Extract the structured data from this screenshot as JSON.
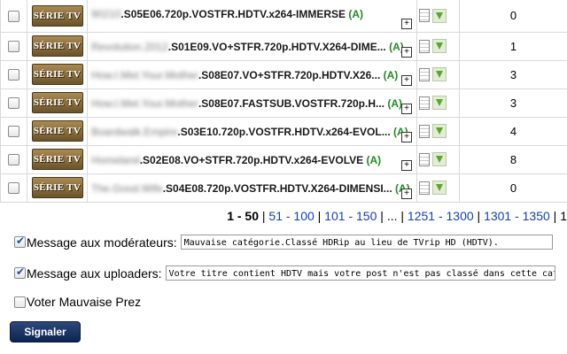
{
  "category_label": "SÉRIE TV",
  "rows": [
    {
      "blurred": "90210",
      "name": ".S05E06.720p.VOSTFR.HDTV.x264-IMMERSE",
      "tag": "(A)",
      "count": "0"
    },
    {
      "blurred": "Revolution.2012",
      "name": ".S01E09.VO+STFR.720p.HDTV.X264-DIME...",
      "tag": "(A)",
      "count": "1"
    },
    {
      "blurred": "How.I.Met.Your.Mother",
      "name": ".S08E07.VO+STFR.720p.HDTV.X26...",
      "tag": "(A)",
      "count": "3"
    },
    {
      "blurred": "How.I.Met.Your.Mother",
      "name": ".S08E07.FASTSUB.VOSTFR.720p.H...",
      "tag": "(A)",
      "count": "3"
    },
    {
      "blurred": "Boardwalk.Empire",
      "name": ".S03E10.720p.VOSTFR.HDTV.x264-EVOL...",
      "tag": "(A)",
      "count": "4"
    },
    {
      "blurred": "Homeland",
      "name": ".S02E08.VO+STFR.720p.HDTV.x264-EVOLVE",
      "tag": "(A)",
      "count": "8"
    },
    {
      "blurred": "The.Good.Wife",
      "name": ".S04E08.720p.VOSTFR.HDTV.X264-DIMENSI...",
      "tag": "(A)",
      "count": "0"
    }
  ],
  "pagination": {
    "current": "1 - 50",
    "sep": " | ",
    "links": [
      "51 - 100",
      "101 - 150",
      "...",
      "1251 - 1300",
      "1301 - 1350"
    ],
    "trailing": " | 1"
  },
  "form": {
    "moderators_label": "Message aux modérateurs:",
    "moderators_value": "Mauvaise catégorie.Classé HDRip au lieu de TVrip HD (HDTV).",
    "uploaders_label": "Message aux uploaders:",
    "uploaders_value": "Votre titre contient HDTV mais votre post n'est pas classé dans cette catégorie (n",
    "vote_label": "Voter Mauvaise Prez",
    "submit_label": "Signaler"
  },
  "colors": {
    "accent_link": "#1240b8",
    "tag_green": "#1f8a1f",
    "button_bg": "#0c2350"
  }
}
